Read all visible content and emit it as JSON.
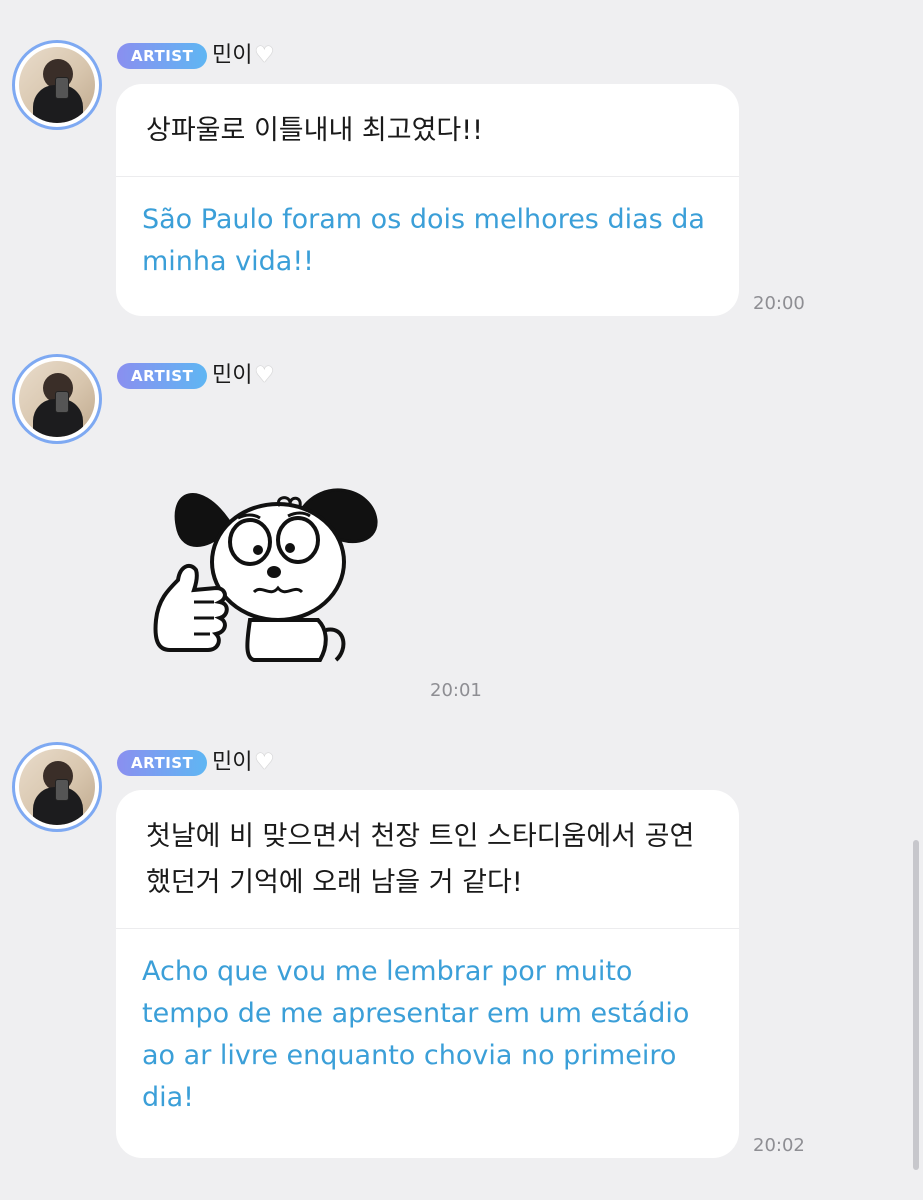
{
  "messages": [
    {
      "badge": "ARTIST",
      "name": "민이",
      "korean": "상파울로 이틀내내 최고였다!!",
      "translation": "São Paulo foram os dois melhores dias da minha vida!!",
      "time": "20:00"
    },
    {
      "badge": "ARTIST",
      "name": "민이",
      "sticker": "thumbs-up-puppy-sticker",
      "time": "20:01"
    },
    {
      "badge": "ARTIST",
      "name": "민이",
      "korean": "첫날에 비 맞으면서 천장 트인 스타디움에서 공연했던거 기억에 오래 남을 거 같다!",
      "translation": "Acho que vou me lembrar por muito tempo de me apresentar em um estádio ao ar livre enquanto chovia no primeiro dia!",
      "time": "20:02"
    }
  ],
  "colors": {
    "background": "#efeff1",
    "bubble": "#ffffff",
    "translation_text": "#3b9fd8",
    "badge_gradient_start": "#8a8ff0",
    "badge_gradient_end": "#5fb6f3",
    "avatar_ring": "#7ea9f2"
  },
  "icons": {
    "heart": "white-heart-icon"
  }
}
